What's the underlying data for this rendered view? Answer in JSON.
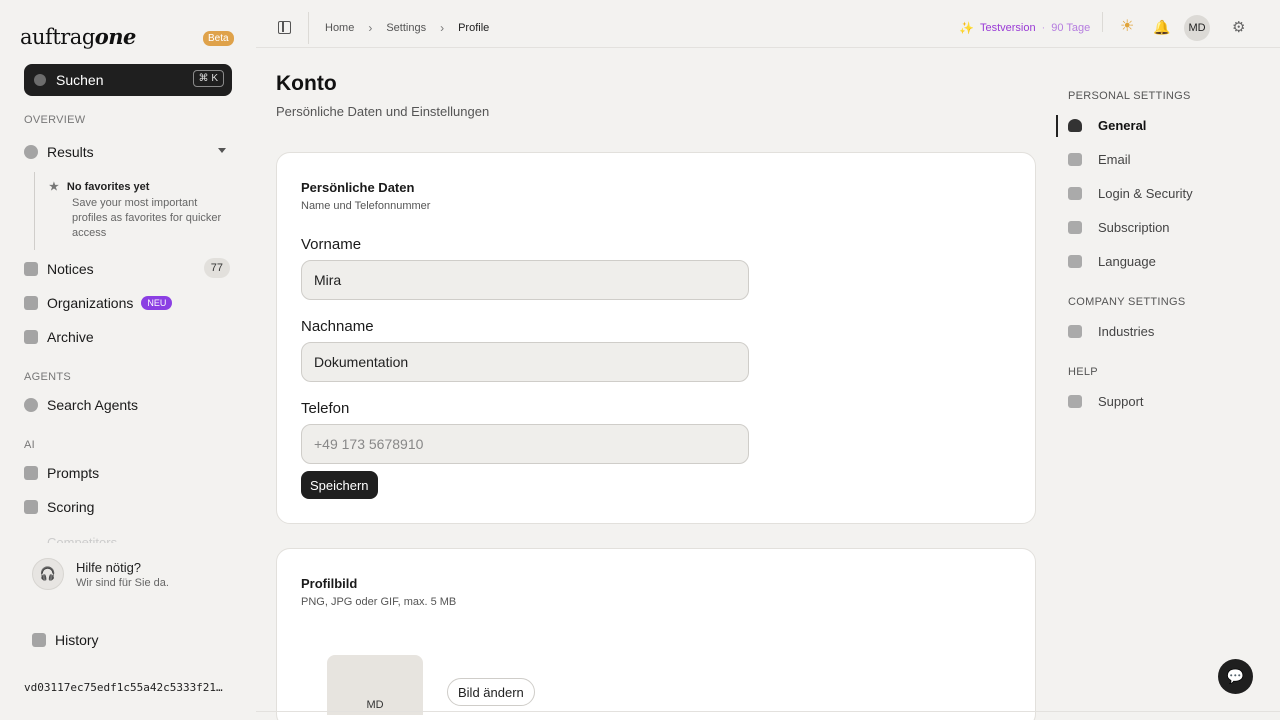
{
  "brand": {
    "logo_light": "auftrag",
    "logo_bold": "one",
    "badge": "Beta"
  },
  "search": {
    "label": "Suchen",
    "shortcut": "⌘ K"
  },
  "sidebar": {
    "overview_label": "OVERVIEW",
    "results": "Results",
    "favorites": {
      "title": "No favorites yet",
      "text": "Save your most important profiles as favorites for quicker access"
    },
    "notices": "Notices",
    "notices_count": "77",
    "organizations": "Organizations",
    "organizations_badge": "NEU",
    "archive": "Archive",
    "agents_label": "AGENTS",
    "search_agents": "Search Agents",
    "ai_label": "AI",
    "prompts": "Prompts",
    "scoring": "Scoring",
    "faded_item": "Competitors",
    "help_title": "Hilfe nötig?",
    "help_sub": "Wir sind für Sie da.",
    "history": "History",
    "hash": "vd03117ec75edf1c55a42c5333f21…"
  },
  "topbar": {
    "breadcrumb": [
      "Home",
      "Settings",
      "Profile"
    ],
    "trial_label": "Testversion",
    "trial_days": "90 Tage",
    "avatar": "MD"
  },
  "main": {
    "title": "Konto",
    "subtitle": "Persönliche Daten und Einstellungen",
    "personal": {
      "title": "Persönliche Daten",
      "subtitle": "Name und Telefonnummer",
      "first_name_label": "Vorname",
      "first_name_value": "Mira",
      "last_name_label": "Nachname",
      "last_name_value": "Dokumentation",
      "phone_label": "Telefon",
      "phone_placeholder": "+49 173 5678910",
      "save": "Speichern"
    },
    "picture": {
      "title": "Profilbild",
      "subtitle": "PNG, JPG oder GIF, max. 5 MB",
      "initials": "MD",
      "change": "Bild ändern"
    }
  },
  "settings_nav": {
    "personal_label": "PERSONAL SETTINGS",
    "general": "General",
    "email": "Email",
    "login_security": "Login & Security",
    "subscription": "Subscription",
    "language": "Language",
    "company_label": "COMPANY SETTINGS",
    "industries": "Industries",
    "help_label": "HELP",
    "support": "Support"
  },
  "colors": {
    "accent": "#9a3bd6",
    "beta": "#dfa24a",
    "neu": "#8b3fe3"
  }
}
